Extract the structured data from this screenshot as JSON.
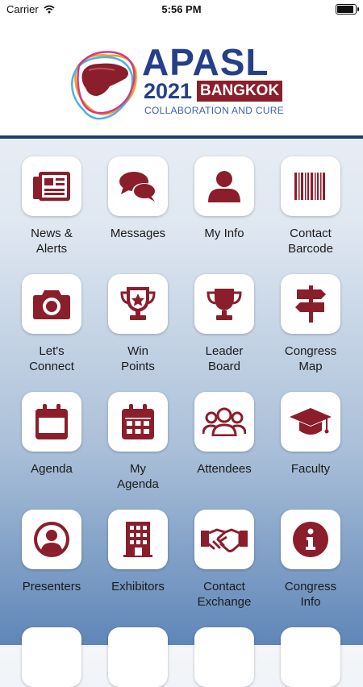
{
  "status_bar": {
    "carrier": "Carrier",
    "time": "5:56 PM",
    "battery_level": 1.0
  },
  "header": {
    "logo_main": "APASL",
    "logo_year": "2021",
    "logo_city": "BANGKOK",
    "logo_tagline": "COLLABORATION AND CURE"
  },
  "colors": {
    "icon": "#8b1e2b",
    "header_rule": "#1f3c6e",
    "logo_blue": "#263f8a"
  },
  "tiles": [
    {
      "label": "News &\nAlerts",
      "icon": "newspaper-icon"
    },
    {
      "label": "Messages",
      "icon": "chat-bubbles-icon"
    },
    {
      "label": "My Info",
      "icon": "user-icon"
    },
    {
      "label": "Contact\nBarcode",
      "icon": "barcode-icon"
    },
    {
      "label": "Let's\nConnect",
      "icon": "camera-icon"
    },
    {
      "label": "Win\nPoints",
      "icon": "trophy-star-icon"
    },
    {
      "label": "Leader\nBoard",
      "icon": "trophy-icon"
    },
    {
      "label": "Congress\nMap",
      "icon": "signpost-icon"
    },
    {
      "label": "Agenda",
      "icon": "calendar-icon"
    },
    {
      "label": "My\nAgenda",
      "icon": "calendar-grid-icon"
    },
    {
      "label": "Attendees",
      "icon": "users-icon"
    },
    {
      "label": "Faculty",
      "icon": "graduation-cap-icon"
    },
    {
      "label": "Presenters",
      "icon": "user-circle-icon"
    },
    {
      "label": "Exhibitors",
      "icon": "building-icon"
    },
    {
      "label": "Contact\nExchange",
      "icon": "handshake-icon"
    },
    {
      "label": "Congress\nInfo",
      "icon": "info-icon"
    }
  ]
}
